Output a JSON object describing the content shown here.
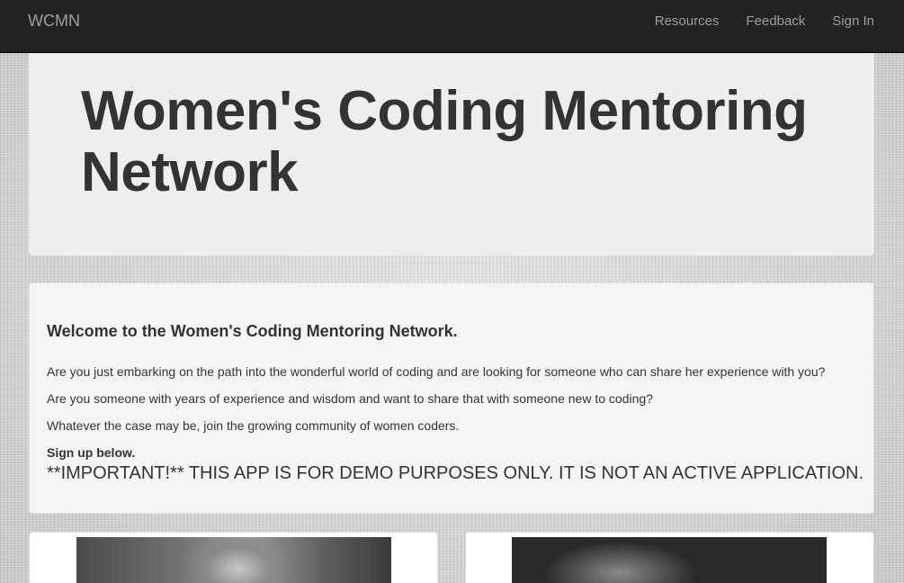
{
  "navbar": {
    "brand": "WCMN",
    "links": [
      "Resources",
      "Feedback",
      "Sign In"
    ]
  },
  "jumbotron": {
    "title": "Women's Coding Mentoring Network"
  },
  "welcome": {
    "heading": "Welcome to the Women's Coding Mentoring Network.",
    "paragraphs": [
      "Are you just embarking on the path into the wonderful world of coding and are looking for someone who can share her experience with you?",
      "Are you someone with years of experience and wisdom and want to share that with someone new to coding?",
      "Whatever the case may be, join the growing community of women coders."
    ],
    "signup": "Sign up below.",
    "important": "**IMPORTANT!** THIS APP IS FOR DEMO PURPOSES ONLY. IT IS NOT AN ACTIVE APPLICATION."
  },
  "colors": {
    "navbar_bg": "#222222",
    "nav_text": "#9d9d9d",
    "jumbotron_bg": "#eeeeee",
    "panel_bg": "#f5f5f5",
    "text": "#333333"
  },
  "icons": {
    "left_card_image": "woman-portrait-photo",
    "right_card_image": "woman-portrait-photo"
  }
}
